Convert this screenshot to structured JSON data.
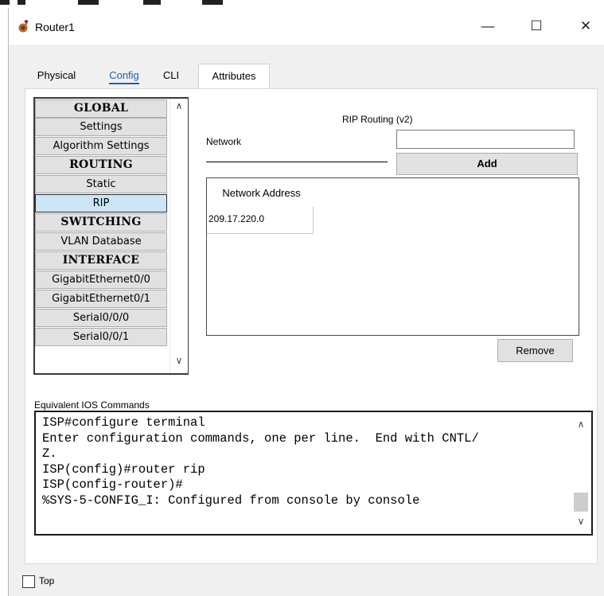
{
  "window": {
    "title": "Router1",
    "minimize_glyph": "—",
    "maximize_glyph": "☐",
    "close_glyph": "✕",
    "app_icon": "router-icon"
  },
  "tabs": [
    {
      "label": "Physical"
    },
    {
      "label": "Config",
      "active": true
    },
    {
      "label": "CLI"
    },
    {
      "label": "Attributes"
    }
  ],
  "sidebar": {
    "items": [
      {
        "label": "GLOBAL",
        "type": "header"
      },
      {
        "label": "Settings"
      },
      {
        "label": "Algorithm Settings"
      },
      {
        "label": "ROUTING",
        "type": "header"
      },
      {
        "label": "Static"
      },
      {
        "label": "RIP",
        "selected": true
      },
      {
        "label": "SWITCHING",
        "type": "header"
      },
      {
        "label": "VLAN Database"
      },
      {
        "label": "INTERFACE",
        "type": "header"
      },
      {
        "label": "GigabitEthernet0/0"
      },
      {
        "label": "GigabitEthernet0/1"
      },
      {
        "label": "Serial0/0/0"
      },
      {
        "label": "Serial0/0/1"
      }
    ]
  },
  "rip": {
    "title": "RIP Routing (v2)",
    "network_label": "Network",
    "network_value": "",
    "add_label": "Add",
    "table_header": "Network Address",
    "networks": [
      "209.17.220.0"
    ],
    "remove_label": "Remove"
  },
  "ios": {
    "label": "Equivalent IOS Commands",
    "text": "ISP#configure terminal\nEnter configuration commands, one per line.  End with CNTL/\nZ.\nISP(config)#router rip\nISP(config-router)#\n%SYS-5-CONFIG_I: Configured from console by console"
  },
  "footer": {
    "top_label": "Top",
    "top_checked": false
  },
  "colors": {
    "accent": "#1a5fb4",
    "selected_item": "#cde6f7",
    "button_face": "#e1e1e1"
  }
}
